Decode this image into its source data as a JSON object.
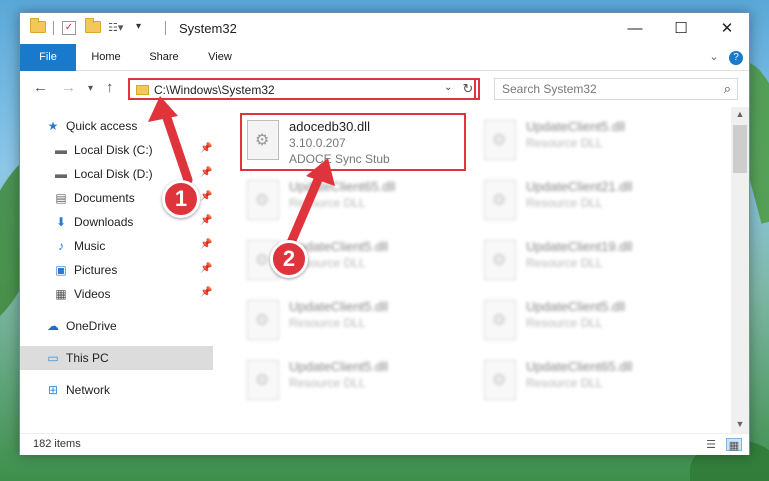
{
  "titlebar": {
    "title": "System32",
    "minimize_glyph": "—",
    "maximize_glyph": "☐",
    "close_glyph": "✕"
  },
  "ribbon": {
    "tabs": [
      {
        "label": "File"
      },
      {
        "label": "Home"
      },
      {
        "label": "Share"
      },
      {
        "label": "View"
      }
    ]
  },
  "nav": {
    "address": "C:\\Windows\\System32",
    "search_placeholder": "Search System32"
  },
  "sidebar": {
    "items": [
      {
        "label": "Quick access",
        "icon": "star-icon"
      },
      {
        "label": "Local Disk (C:)",
        "icon": "drive-icon"
      },
      {
        "label": "Local Disk (D:)",
        "icon": "drive-icon"
      },
      {
        "label": "Documents",
        "icon": "documents-icon"
      },
      {
        "label": "Downloads",
        "icon": "download-icon"
      },
      {
        "label": "Music",
        "icon": "music-icon"
      },
      {
        "label": "Pictures",
        "icon": "pictures-icon"
      },
      {
        "label": "Videos",
        "icon": "videos-icon"
      },
      {
        "label": "OneDrive",
        "icon": "cloud-icon"
      },
      {
        "label": "This PC",
        "icon": "computer-icon"
      },
      {
        "label": "Network",
        "icon": "network-icon"
      }
    ]
  },
  "files": [
    {
      "name": "adocedb30.dll",
      "version": "3.10.0.207",
      "description": "ADOCE Sync Stub"
    },
    {
      "name": "UpdateClient5.dll",
      "description": "Resource DLL"
    },
    {
      "name": "UpdateClient65.dll",
      "description": "Resource DLL"
    },
    {
      "name": "UpdateClient21.dll",
      "description": "Resource DLL"
    },
    {
      "name": "UpdateClient5.dll",
      "description": "Resource DLL"
    },
    {
      "name": "UpdateClient19.dll",
      "description": "Resource DLL"
    },
    {
      "name": "UpdateClient5.dll",
      "description": "Resource DLL"
    },
    {
      "name": "UpdateClient5.dll",
      "description": "Resource DLL"
    },
    {
      "name": "UpdateClient5.dll",
      "description": "Resource DLL"
    },
    {
      "name": "UpdateClient65.dll",
      "description": "Resource DLL"
    }
  ],
  "status": {
    "item_count": "182 items"
  },
  "annotations": {
    "step1": "1",
    "step2": "2",
    "color": "#e0343c"
  }
}
